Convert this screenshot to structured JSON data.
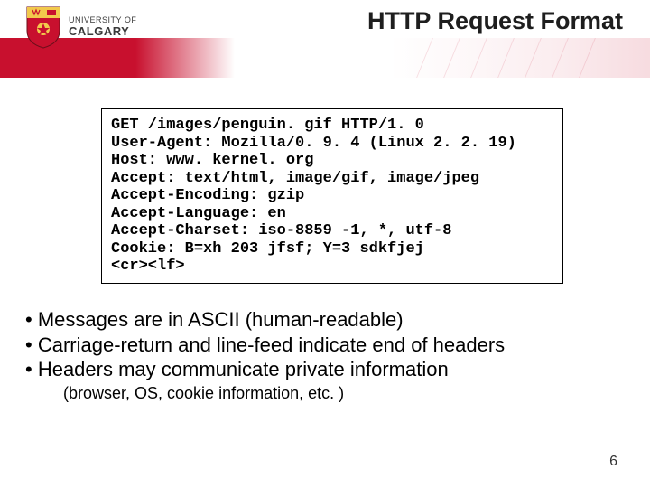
{
  "logo": {
    "university_of": "UNIVERSITY OF",
    "name": "CALGARY"
  },
  "title": "HTTP Request Format",
  "code_lines": [
    "GET /images/penguin. gif HTTP/1. 0",
    "User-Agent: Mozilla/0. 9. 4 (Linux 2. 2. 19)",
    "Host: www. kernel. org",
    "Accept: text/html, image/gif, image/jpeg",
    "Accept-Encoding: gzip",
    "Accept-Language: en",
    "Accept-Charset: iso-8859 -1, *, utf-8",
    "Cookie: B=xh 203 jfsf; Y=3 sdkfjej",
    "<cr><lf>"
  ],
  "bullets": {
    "b1": "Messages are in ASCII (human-readable)",
    "b2": "Carriage-return and line-feed indicate end of headers",
    "b3": "Headers may communicate private information",
    "sub": "(browser, OS, cookie information, etc. )"
  },
  "page_number": "6"
}
